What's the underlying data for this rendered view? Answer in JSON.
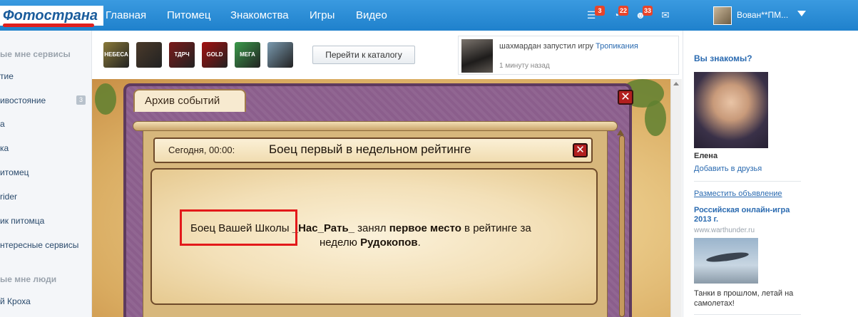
{
  "header": {
    "logo": "Фотострана",
    "nav": [
      "Главная",
      "Питомец",
      "Знакомства",
      "Игры",
      "Видео"
    ],
    "badges": {
      "feed": "3",
      "events": "22",
      "friends": "33"
    },
    "icons": [
      "feed-icon",
      "events-icon",
      "friends-icon",
      "mail-icon"
    ],
    "username": "Вован**ПМ..."
  },
  "left_sidebar": {
    "section1": "ые мне сервисы",
    "items": [
      "тие",
      "ивостояние",
      "а",
      "ка",
      "итомец",
      "rider",
      "ик питомца",
      "нтересные сервисы"
    ],
    "standoff_count": "3",
    "section2": "ые мне люди",
    "people": [
      "й Кроха"
    ]
  },
  "games": {
    "icons": [
      {
        "name": "heaven-game-icon",
        "label": "НЕБЕСА",
        "color": "#8a7a3a"
      },
      {
        "name": "battle-game-icon",
        "label": "",
        "color": "#4a3a2a"
      },
      {
        "name": "tdrive-game-icon",
        "label": "ТДРЧ",
        "color": "#7a1a1a"
      },
      {
        "name": "gold-slots-game-icon",
        "label": "GOLD SLOTS",
        "color": "#a41010"
      },
      {
        "name": "mega-game-icon",
        "label": "МЕГА",
        "color": "#3a9a4a"
      },
      {
        "name": "sky-game-icon",
        "label": "",
        "color": "#7a9ab0"
      }
    ],
    "catalog_button": "Перейти к каталогу"
  },
  "feed": {
    "user": "шахмардан",
    "action": "запустил игру",
    "game": "Тропикания",
    "time": "1 минуту назад"
  },
  "dialog": {
    "tab_title": "Архив событий",
    "event_date": "Сегодня, 00:00:",
    "event_title": "Боец первый в недельном рейтинге",
    "line1_a": "Боец Вашей Школы ",
    "line1_b": "_Нас_Рать_",
    "line1_c": " занял ",
    "line1_d": "первое место",
    "line1_e": " в рейтинге за",
    "line2_a": "неделю ",
    "line2_b": "Рудокопов",
    "line2_c": "."
  },
  "right_sidebar": {
    "title": "Вы знакомы?",
    "person_name": "Елена",
    "add_friend": "Добавить в друзья",
    "ad_link": "Разместить объявление",
    "ad_title": "Российская онлайн-игра 2013 г.",
    "ad_url": "www.warthunder.ru",
    "ad_text": "Танки в прошлом, летай на самолетах!"
  }
}
